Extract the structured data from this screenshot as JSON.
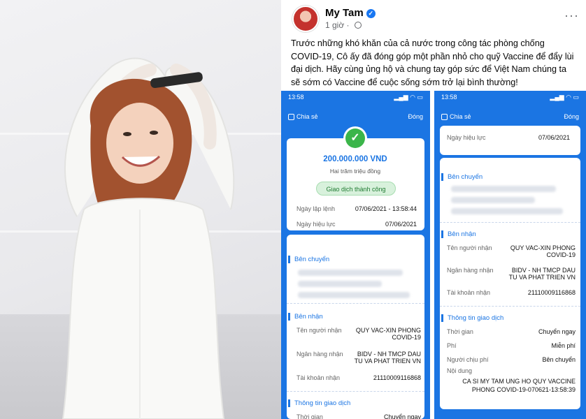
{
  "post": {
    "author": "My Tam",
    "time": "1 giờ",
    "caption": "Trước những khó khăn của cả nước trong công tác phòng chống COVID-19, Cô ấy đã đóng góp một phần nhỏ cho quỹ Vaccine để đẩy lùi đại dịch. Hãy cùng ủng hộ và chung tay góp sức để Việt Nam chúng ta sẽ sớm có Vaccine để cuộc sống sớm trở lại bình thường!"
  },
  "phone_left": {
    "time": "13:58",
    "share": "Chia sẻ",
    "close": "Đóng",
    "amount": "200.000.000 VND",
    "amount_words": "Hai trăm triệu đồng",
    "status": "Giao dịch thành công",
    "created_label": "Ngày lập lệnh",
    "created_value": "07/06/2021 - 13:58:44",
    "effective_label": "Ngày hiệu lực",
    "effective_value": "07/06/2021",
    "sender_section": "Bên chuyển",
    "receiver_section": "Bên nhận",
    "recipient_label": "Tên người nhận",
    "recipient_value": "QUY VAC-XIN PHONG COVID-19",
    "bank_label": "Ngân hàng nhận",
    "bank_value": "BIDV - NH TMCP DAU TU VA PHAT TRIEN VN",
    "account_label": "Tài khoản nhận",
    "account_value": "21110009116868",
    "txn_section": "Thông tin giao dịch",
    "txn_time_label": "Thời gian",
    "txn_time_value": "Chuyển ngay"
  },
  "phone_right": {
    "time": "13:58",
    "share": "Chia sẻ",
    "close": "Đóng",
    "effective_label": "Ngày hiệu lực",
    "effective_value": "07/06/2021",
    "sender_section": "Bên chuyển",
    "receiver_section": "Bên nhận",
    "recipient_label": "Tên người nhận",
    "recipient_value": "QUY VAC-XIN PHONG COVID-19",
    "bank_label": "Ngân hàng nhận",
    "bank_value": "BIDV - NH TMCP DAU TU VA PHAT TRIEN VN",
    "account_label": "Tài khoản nhận",
    "account_value": "21110009116868",
    "txn_section": "Thông tin giao dịch",
    "time_label": "Thời gian",
    "time_value": "Chuyển ngay",
    "fee_label": "Phí",
    "fee_value": "Miễn phí",
    "payer_label": "Người chịu phí",
    "payer_value": "Bên chuyển",
    "content_label": "Nội dung",
    "content_value": "CA SI MY TAM UNG HO QUY VACCINE PHONG COVID-19-070621-13:58:39"
  },
  "colors": {
    "accent": "#1b75e3",
    "success": "#3bb54a",
    "fb_blue": "#1877f2"
  }
}
